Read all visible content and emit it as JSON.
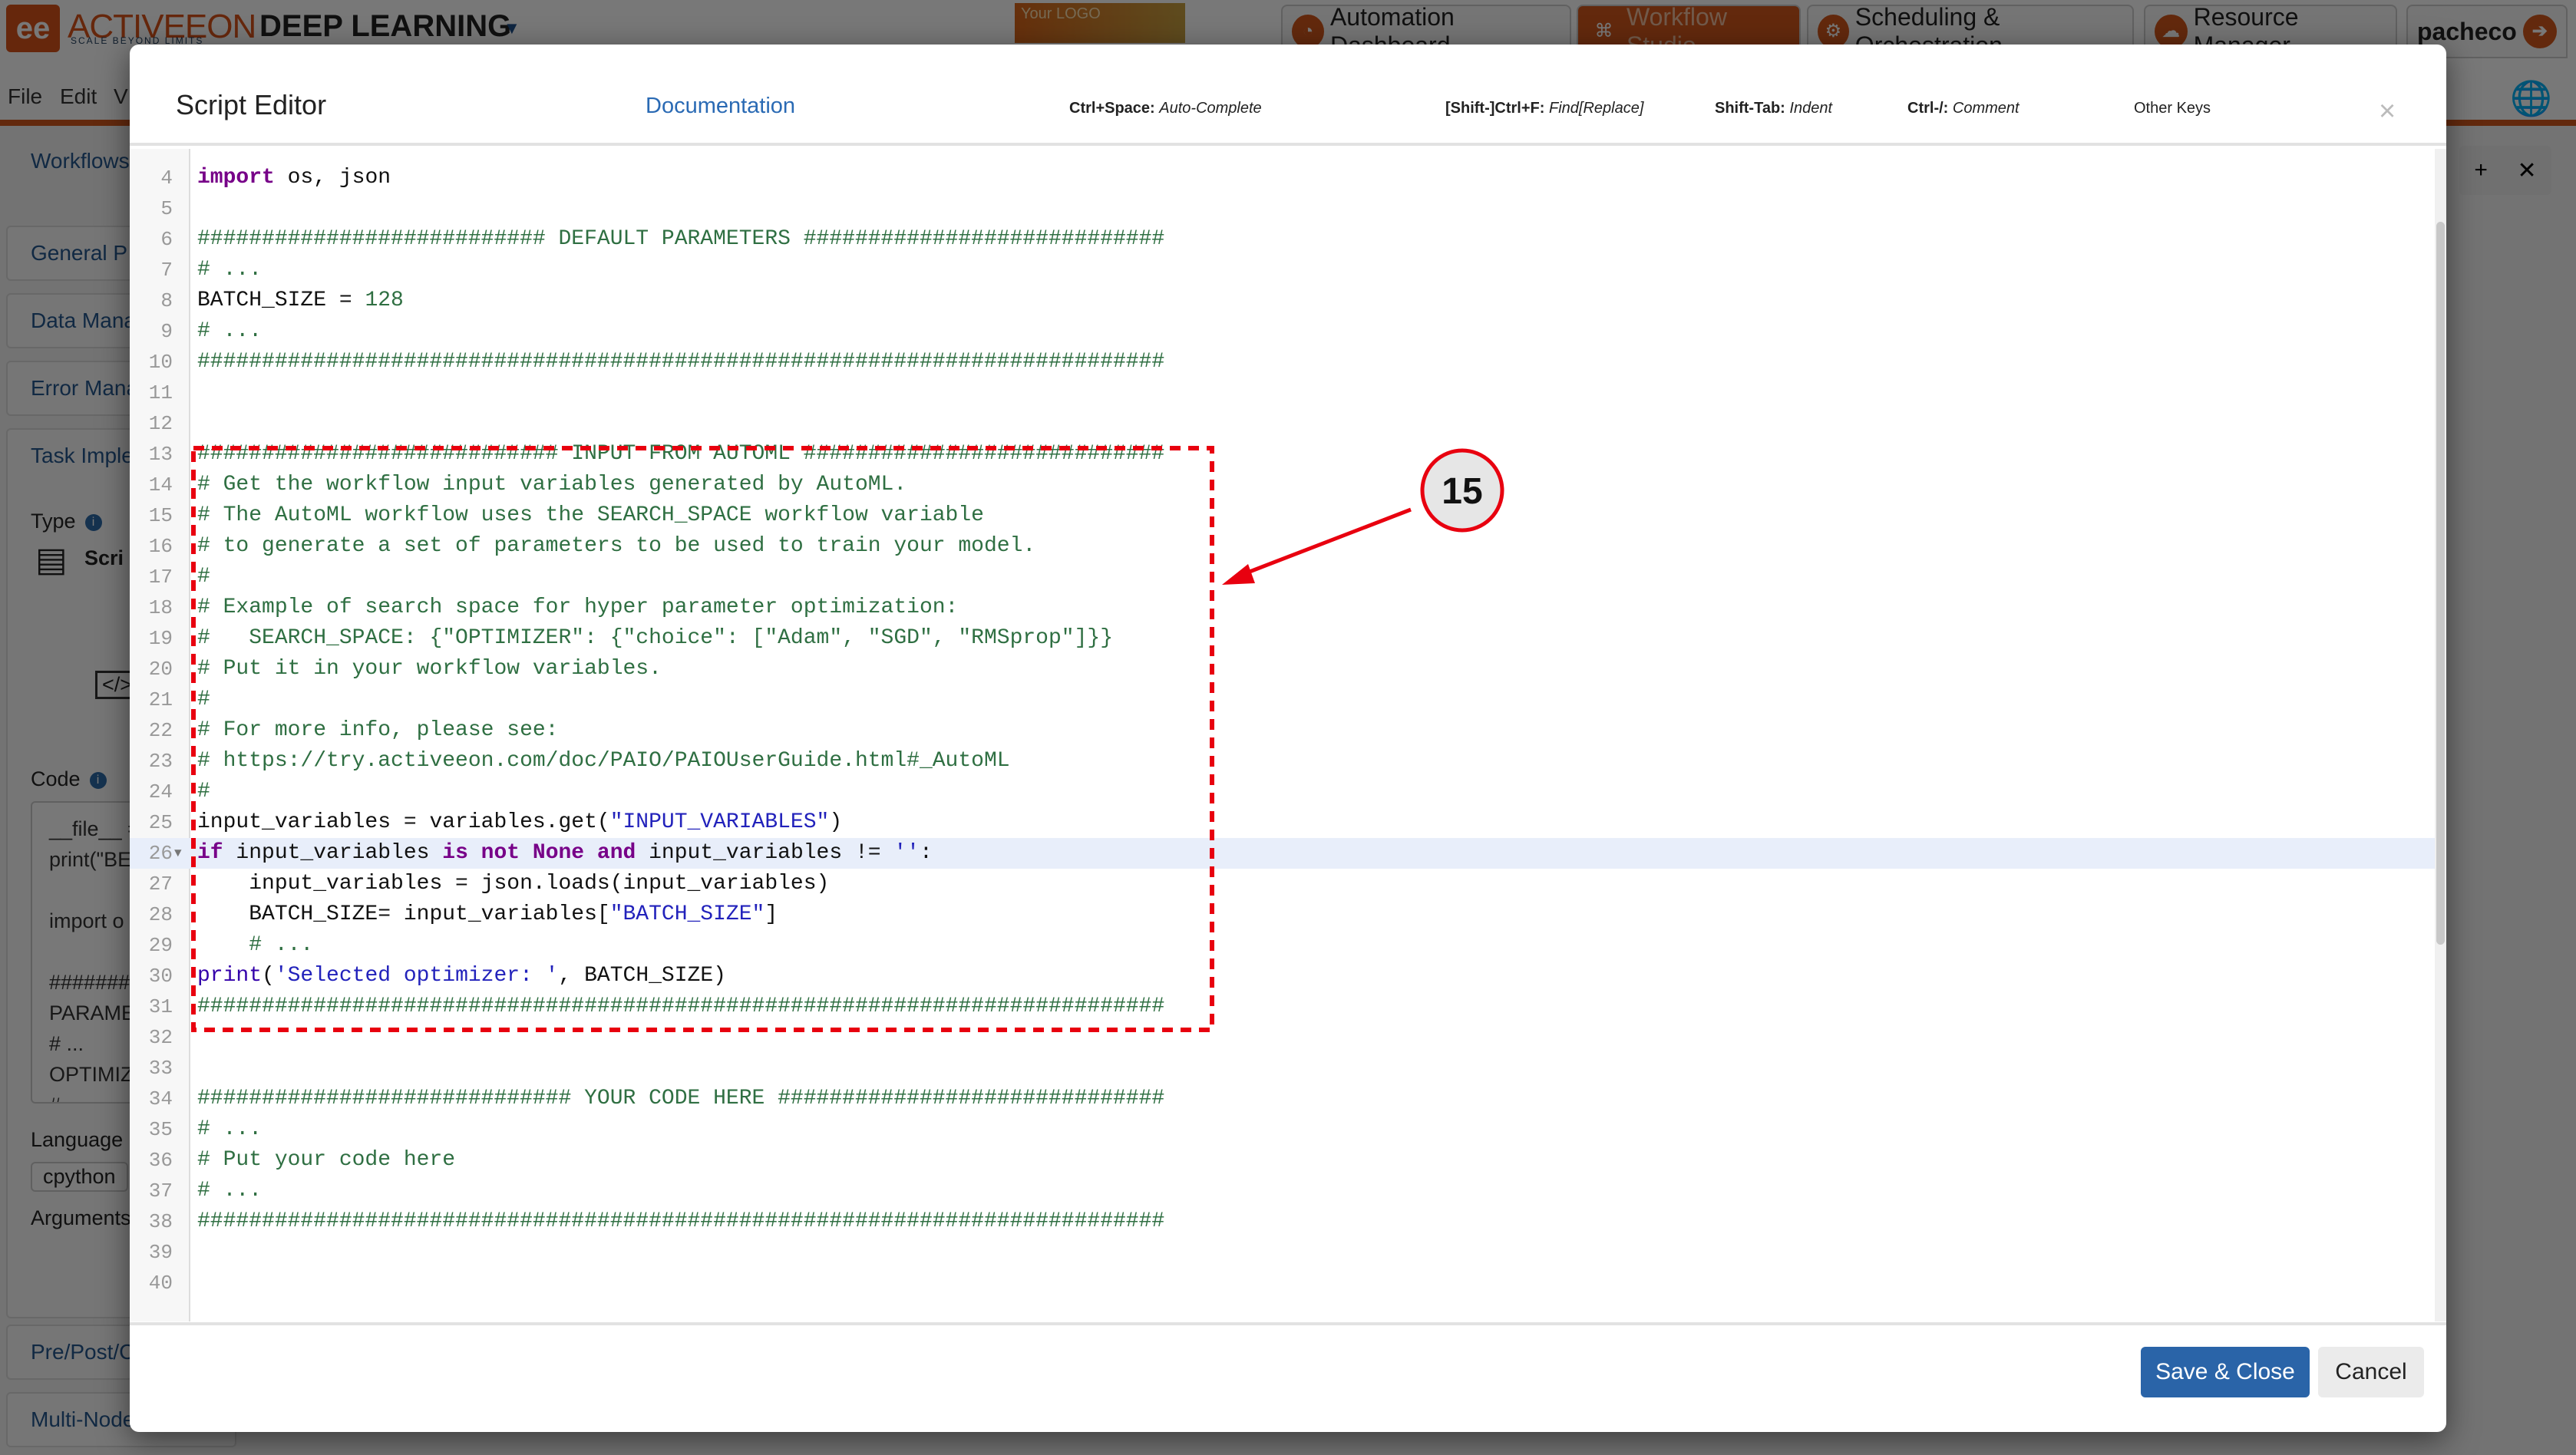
{
  "background_app": {
    "logo_mark": "ee",
    "logo_text": "ACTIVEEON",
    "logo_tagline": "SCALE BEYOND LIMITS",
    "app_title": "DEEP LEARNING",
    "your_logo": "Your LOGO",
    "nav_tabs": [
      {
        "label": "Automation Dashboard",
        "icon": "dashboard-icon",
        "active": false
      },
      {
        "label": "Workflow Studio",
        "icon": "workflow-icon",
        "active": true
      },
      {
        "label": "Scheduling & Orchestration",
        "icon": "gears-icon",
        "active": false
      },
      {
        "label": "Resource Manager",
        "icon": "cloud-icon",
        "active": false
      }
    ],
    "user": "pacheco",
    "menu": [
      "File",
      "Edit",
      "V"
    ],
    "left_panel": {
      "workflows": "Workflows",
      "sections": [
        "General P",
        "Data Mana",
        "Error Mana",
        "Task Imple"
      ],
      "type_label": "Type",
      "type_value": "Scri",
      "code_label": "Code",
      "code_preview": [
        "__file__ =",
        "print(\"BE",
        "",
        "import o",
        "",
        "########",
        "PARAME",
        "# ...",
        "OPTIMIZ",
        "#"
      ],
      "language_label": "Language",
      "language_value": "cpython",
      "arguments_label": "Arguments",
      "lower_sections": [
        "Pre/Post/C",
        "Multi-Node"
      ]
    }
  },
  "modal": {
    "title": "Script Editor",
    "documentation_link": "Documentation",
    "shortcuts": [
      {
        "key": "Ctrl+Space:",
        "action": "Auto-Complete"
      },
      {
        "key": "[Shift-]Ctrl+F:",
        "action": "Find[Replace]"
      },
      {
        "key": "Shift-Tab:",
        "action": "Indent"
      },
      {
        "key": "Ctrl-/:",
        "action": "Comment"
      }
    ],
    "other_keys": "Other Keys",
    "close_icon": "×",
    "save_button": "Save & Close",
    "cancel_button": "Cancel",
    "highlighted_line": 26,
    "folded_line": 26,
    "code_lines": [
      {
        "n": "4",
        "tokens": [
          [
            "import",
            "kw"
          ],
          [
            " os, json",
            ""
          ]
        ]
      },
      {
        "n": "5",
        "tokens": []
      },
      {
        "n": "6",
        "tokens": [
          [
            "########################### DEFAULT PARAMETERS ############################",
            "cm"
          ]
        ]
      },
      {
        "n": "7",
        "tokens": [
          [
            "# ...",
            "cm"
          ]
        ]
      },
      {
        "n": "8",
        "tokens": [
          [
            "BATCH_SIZE = ",
            ""
          ],
          [
            "128",
            "nm"
          ]
        ]
      },
      {
        "n": "9",
        "tokens": [
          [
            "# ...",
            "cm"
          ]
        ]
      },
      {
        "n": "10",
        "tokens": [
          [
            "###########################################################################",
            "cm"
          ]
        ]
      },
      {
        "n": "11",
        "tokens": []
      },
      {
        "n": "12",
        "tokens": []
      },
      {
        "n": "13",
        "tokens": [
          [
            "############################ INPUT FROM AUTOML ############################",
            "cm"
          ]
        ]
      },
      {
        "n": "14",
        "tokens": [
          [
            "# Get the workflow input variables generated by AutoML.",
            "cm"
          ]
        ]
      },
      {
        "n": "15",
        "tokens": [
          [
            "# The AutoML workflow uses the SEARCH_SPACE workflow variable",
            "cm"
          ]
        ]
      },
      {
        "n": "16",
        "tokens": [
          [
            "# to generate a set of parameters to be used to train your model.",
            "cm"
          ]
        ]
      },
      {
        "n": "17",
        "tokens": [
          [
            "#",
            "cm"
          ]
        ]
      },
      {
        "n": "18",
        "tokens": [
          [
            "# Example of search space for hyper parameter optimization:",
            "cm"
          ]
        ]
      },
      {
        "n": "19",
        "tokens": [
          [
            "#   SEARCH_SPACE: {\"OPTIMIZER\": {\"choice\": [\"Adam\", \"SGD\", \"RMSprop\"]}}",
            "cm"
          ]
        ]
      },
      {
        "n": "20",
        "tokens": [
          [
            "# Put it in your workflow variables.",
            "cm"
          ]
        ]
      },
      {
        "n": "21",
        "tokens": [
          [
            "#",
            "cm"
          ]
        ]
      },
      {
        "n": "22",
        "tokens": [
          [
            "# For more info, please see:",
            "cm"
          ]
        ]
      },
      {
        "n": "23",
        "tokens": [
          [
            "# https://try.activeeon.com/doc/PAIO/PAIOUserGuide.html#_AutoML",
            "cm"
          ]
        ]
      },
      {
        "n": "24",
        "tokens": [
          [
            "#",
            "cm"
          ]
        ]
      },
      {
        "n": "25",
        "tokens": [
          [
            "input_variables = variables.get(",
            ""
          ],
          [
            "\"INPUT_VARIABLES\"",
            "st"
          ],
          [
            ")",
            ""
          ]
        ]
      },
      {
        "n": "26",
        "tokens": [
          [
            "if",
            "kw"
          ],
          [
            " input_variables ",
            ""
          ],
          [
            "is not None and",
            "kw"
          ],
          [
            " input_variables != ",
            ""
          ],
          [
            "''",
            "st"
          ],
          [
            ":",
            ""
          ]
        ]
      },
      {
        "n": "27",
        "tokens": [
          [
            "    input_variables = json.loads(input_variables)",
            ""
          ]
        ]
      },
      {
        "n": "28",
        "tokens": [
          [
            "    BATCH_SIZE= input_variables[",
            ""
          ],
          [
            "\"BATCH_SIZE\"",
            "st"
          ],
          [
            "]",
            ""
          ]
        ]
      },
      {
        "n": "29",
        "tokens": [
          [
            "    ",
            ""
          ],
          [
            "# ...",
            "cm"
          ]
        ]
      },
      {
        "n": "30",
        "tokens": [
          [
            "print",
            "bi"
          ],
          [
            "(",
            ""
          ],
          [
            "'Selected optimizer: '",
            "st"
          ],
          [
            ", BATCH_SIZE)",
            ""
          ]
        ]
      },
      {
        "n": "31",
        "tokens": [
          [
            "###########################################################################",
            "cm"
          ]
        ]
      },
      {
        "n": "32",
        "tokens": []
      },
      {
        "n": "33",
        "tokens": []
      },
      {
        "n": "34",
        "tokens": [
          [
            "############################# YOUR CODE HERE ##############################",
            "cm"
          ]
        ]
      },
      {
        "n": "35",
        "tokens": [
          [
            "# ...",
            "cm"
          ]
        ]
      },
      {
        "n": "36",
        "tokens": [
          [
            "# Put your code here",
            "cm"
          ]
        ]
      },
      {
        "n": "37",
        "tokens": [
          [
            "# ...",
            "cm"
          ]
        ]
      },
      {
        "n": "38",
        "tokens": [
          [
            "###########################################################################",
            "cm"
          ]
        ]
      },
      {
        "n": "39",
        "tokens": []
      },
      {
        "n": "40",
        "tokens": []
      }
    ]
  },
  "annotation": {
    "step_number": "15",
    "color": "#e8000f"
  },
  "colors": {
    "brand_orange": "#d2581c",
    "primary_button": "#2a64a8",
    "link": "#2a6ab4"
  }
}
